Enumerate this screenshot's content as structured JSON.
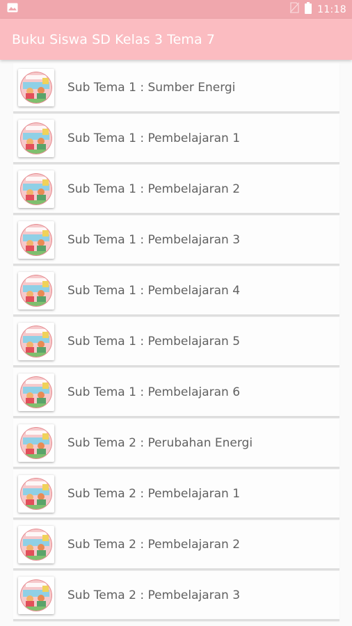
{
  "status_bar": {
    "time": "11:18",
    "icons": [
      "image-notification-icon",
      "no-sim-icon",
      "battery-icon"
    ]
  },
  "app_bar": {
    "title": "Buku Siswa SD Kelas 3 Tema 7"
  },
  "colors": {
    "status_bar": "#f0a7ad",
    "app_bar": "#fbbcc1",
    "background": "#fafafa",
    "item_text": "#616161"
  },
  "items": [
    {
      "label": "Sub Tema 1 : Sumber Energi"
    },
    {
      "label": "Sub Tema 1 : Pembelajaran 1"
    },
    {
      "label": "Sub Tema 1 : Pembelajaran 2"
    },
    {
      "label": "Sub Tema 1 : Pembelajaran 3"
    },
    {
      "label": "Sub Tema 1 : Pembelajaran 4"
    },
    {
      "label": "Sub Tema 1 : Pembelajaran 5"
    },
    {
      "label": "Sub Tema 1 : Pembelajaran 6"
    },
    {
      "label": "Sub Tema 2 : Perubahan Energi"
    },
    {
      "label": "Sub Tema 2 : Pembelajaran 1"
    },
    {
      "label": "Sub Tema 2 : Pembelajaran 2"
    },
    {
      "label": "Sub Tema 2 : Pembelajaran 3"
    }
  ]
}
